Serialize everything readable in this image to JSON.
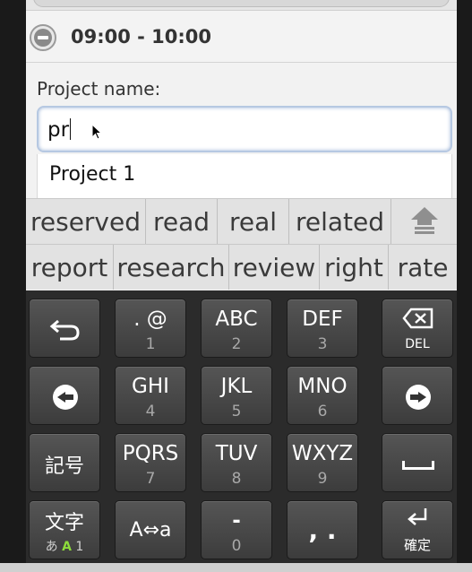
{
  "time_range": "09:00 - 10:00",
  "form": {
    "project_label": "Project name:",
    "input_value": "pr",
    "suggestion": "Project 1"
  },
  "candidates": {
    "row1": [
      "reserved",
      "read",
      "real",
      "related"
    ],
    "row2": [
      "report",
      "research",
      "review",
      "right",
      "rate"
    ]
  },
  "keyboard": {
    "rows": [
      [
        {
          "main": "",
          "sub": "",
          "icon": "undo-arrow-icon"
        },
        {
          "main": ". @",
          "sub": "1"
        },
        {
          "main": "ABC",
          "sub": "2"
        },
        {
          "main": "DEF",
          "sub": "3"
        },
        {
          "main": "",
          "sub": "DEL",
          "icon": "backspace-icon"
        }
      ],
      [
        {
          "main": "",
          "sub": "",
          "icon": "left-arrow-icon"
        },
        {
          "main": "GHI",
          "sub": "4"
        },
        {
          "main": "JKL",
          "sub": "5"
        },
        {
          "main": "MNO",
          "sub": "6"
        },
        {
          "main": "",
          "sub": "",
          "icon": "right-arrow-icon"
        }
      ],
      [
        {
          "main": "記号",
          "sub": ""
        },
        {
          "main": "PQRS",
          "sub": "7"
        },
        {
          "main": "TUV",
          "sub": "8"
        },
        {
          "main": "WXYZ",
          "sub": "9"
        },
        {
          "main": "",
          "sub": "",
          "icon": "space-icon"
        }
      ],
      [
        {
          "main": "文字",
          "sub_a": "あ",
          "sub_b": "A",
          "sub_c": "1"
        },
        {
          "main": "A⇔a",
          "sub": ""
        },
        {
          "main": "-",
          "sub": "0"
        },
        {
          "main": ",  .",
          "sub": ""
        },
        {
          "main": "",
          "sub": "確定",
          "icon": "enter-icon"
        }
      ]
    ]
  }
}
